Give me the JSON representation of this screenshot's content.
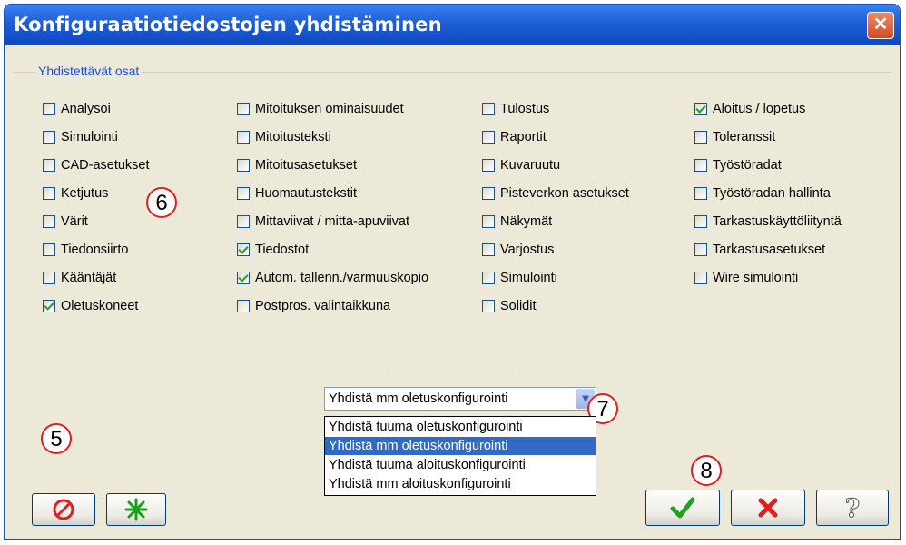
{
  "window": {
    "title": "Konfiguraatiotiedostojen yhdistäminen",
    "close_glyph": "✕"
  },
  "group": {
    "label": "Yhdistettävät osat"
  },
  "columns": [
    [
      {
        "label": "Analysoi",
        "checked": false
      },
      {
        "label": "Simulointi",
        "checked": false
      },
      {
        "label": "CAD-asetukset",
        "checked": false
      },
      {
        "label": "Ketjutus",
        "checked": false
      },
      {
        "label": "Värit",
        "checked": false
      },
      {
        "label": "Tiedonsiirto",
        "checked": false
      },
      {
        "label": "Kääntäjät",
        "checked": false
      },
      {
        "label": "Oletuskoneet",
        "checked": true
      }
    ],
    [
      {
        "label": "Mitoituksen ominaisuudet",
        "checked": false
      },
      {
        "label": "Mitoitusteksti",
        "checked": false
      },
      {
        "label": "Mitoitusasetukset",
        "checked": false
      },
      {
        "label": "Huomautustekstit",
        "checked": false
      },
      {
        "label": "Mittaviivat / mitta-apuviivat",
        "checked": false
      },
      {
        "label": "Tiedostot",
        "checked": true
      },
      {
        "label": "Autom. tallenn./varmuuskopio",
        "checked": true
      },
      {
        "label": "Postpros. valintaikkuna",
        "checked": false
      }
    ],
    [
      {
        "label": "Tulostus",
        "checked": false
      },
      {
        "label": "Raportit",
        "checked": false
      },
      {
        "label": "Kuvaruutu",
        "checked": false
      },
      {
        "label": "Pisteverkon asetukset",
        "checked": false
      },
      {
        "label": "Näkymät",
        "checked": false
      },
      {
        "label": "Varjostus",
        "checked": false
      },
      {
        "label": "Simulointi",
        "checked": false
      },
      {
        "label": "Solidit",
        "checked": false
      }
    ],
    [
      {
        "label": "Aloitus / lopetus",
        "checked": true
      },
      {
        "label": "Toleranssit",
        "checked": false
      },
      {
        "label": "Työstöradat",
        "checked": false
      },
      {
        "label": "Työstöradan hallinta",
        "checked": false
      },
      {
        "label": "Tarkastuskäyttöliityntä",
        "checked": false
      },
      {
        "label": "Tarkastusasetukset",
        "checked": false
      },
      {
        "label": "Wire simulointi",
        "checked": false
      }
    ]
  ],
  "combo": {
    "value": "Yhdistä mm oletuskonfigurointi",
    "options": [
      {
        "label": "Yhdistä tuuma oletuskonfigurointi",
        "selected": false
      },
      {
        "label": "Yhdistä mm oletuskonfigurointi",
        "selected": true
      },
      {
        "label": "Yhdistä tuuma aloituskonfigurointi",
        "selected": false
      },
      {
        "label": "Yhdistä mm aloituskonfigurointi",
        "selected": false
      }
    ]
  },
  "callouts": {
    "c5": "5",
    "c6": "6",
    "c7": "7",
    "c8": "8"
  },
  "buttons": {
    "clear_icon": "no-entry-icon",
    "select_all_icon": "asterisk-icon",
    "ok_icon": "checkmark-icon",
    "cancel_icon": "red-x-icon",
    "help_icon": "question-icon",
    "help_glyph": "?"
  },
  "colors": {
    "title_bar": "#1f5fd6",
    "group_label": "#1f4fd0",
    "selection": "#316ac5",
    "callout_border": "#e02020",
    "ok_green": "#21a121",
    "cancel_red": "#e02020"
  }
}
